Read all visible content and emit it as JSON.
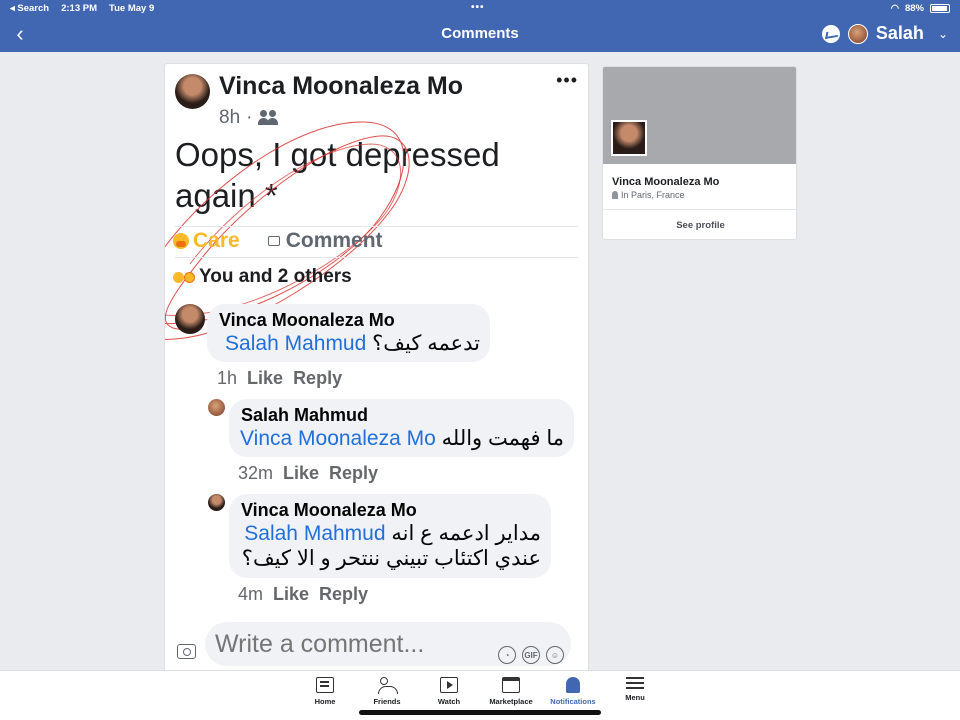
{
  "status_bar": {
    "carrier": "◂ Search",
    "time": "2:13 PM",
    "date": "Tue May 9",
    "battery": "88%"
  },
  "nav": {
    "title": "Comments",
    "user": "Salah"
  },
  "post": {
    "author": "Vinca Moonaleza Mo",
    "time": "8h",
    "text": "Oops, I got depressed again *",
    "care_label": "Care",
    "comment_label": "Comment",
    "reactions_text": "You and 2 others"
  },
  "comments": [
    {
      "name": "Vinca Moonaleza Mo",
      "mention": "Salah Mahmud",
      "text": "تدعمه كيف؟",
      "time": "1h",
      "like": "Like",
      "reply": "Reply"
    },
    {
      "name": "Salah Mahmud",
      "mention": "Vinca Moonaleza Mo",
      "text": "ما فهمت والله",
      "time": "32m",
      "like": "Like",
      "reply": "Reply"
    },
    {
      "name": "Vinca Moonaleza Mo",
      "mention": "Salah Mahmud",
      "text_line1": "مداير ادعمه ع انه",
      "text_line2": "عندي اكتئاب تبيني ننتحر و الا كيف؟",
      "time": "4m",
      "like": "Like",
      "reply": "Reply"
    }
  ],
  "composer": {
    "placeholder": "Write a comment..."
  },
  "profile_card": {
    "name": "Vinca Moonaleza Mo",
    "location": "In Paris, France",
    "button": "See profile"
  },
  "tabs": [
    "Home",
    "Friends",
    "Watch",
    "Marketplace",
    "Notifications",
    "Menu"
  ],
  "colors": {
    "brand": "#4267b2",
    "mention": "#216fdb",
    "care": "#f7b928"
  }
}
